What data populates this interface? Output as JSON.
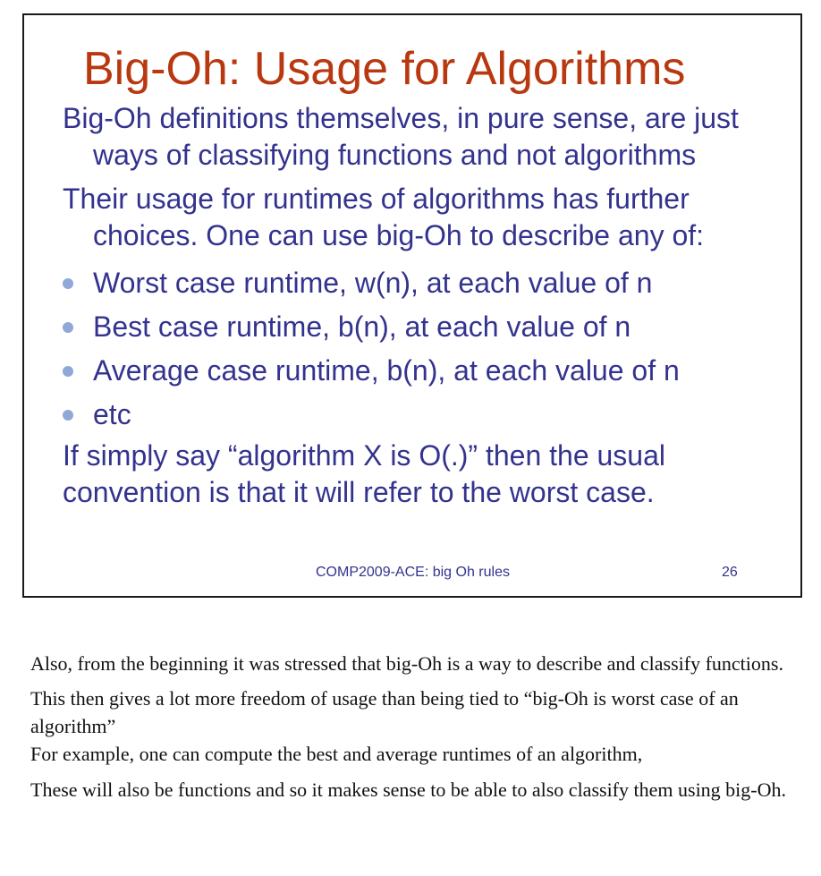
{
  "slide": {
    "title": "Big-Oh: Usage for Algorithms",
    "paragraph1": "Big-Oh definitions themselves, in pure sense, are just ways of classifying functions and not algorithms",
    "paragraph2": "Their usage for runtimes of algorithms has further choices.  One can use big-Oh to describe any of:",
    "bullets": [
      "Worst case runtime, w(n), at each value of n",
      "Best case runtime, b(n), at each value of n",
      "Average case runtime, b(n), at each value of n",
      "etc"
    ],
    "paragraph3": "If simply say “algorithm X is O(.)” then the usual convention is that it will refer to the worst case.",
    "footer": "COMP2009-ACE: big Oh rules",
    "page_number": "26"
  },
  "notes": [
    "Also, from the beginning it was stressed that big-Oh is a way to describe and classify functions.",
    "This then gives a lot more freedom of usage than being tied to “big-Oh is worst case of an algorithm”",
    "For example, one can compute the best and average runtimes of an algorithm,",
    "These will also be functions and so it makes sense to be able to also classify them using big-Oh."
  ]
}
